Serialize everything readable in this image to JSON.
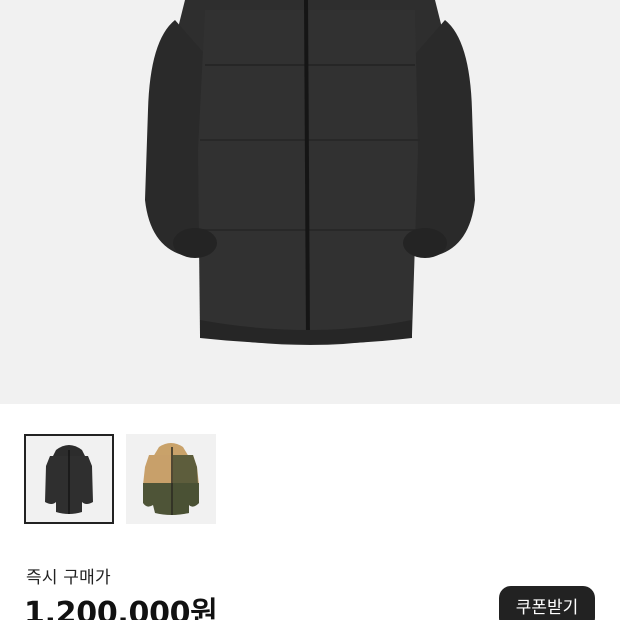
{
  "product": {
    "main_image": "black-insulated-jacket-photo",
    "thumbnails": [
      {
        "name": "black-jacket-thumbnail",
        "selected": true
      },
      {
        "name": "tan-olive-jacket-thumbnail",
        "selected": false
      }
    ]
  },
  "purchase": {
    "price_label": "즉시 구매가",
    "price_value": "1,200,000원",
    "coupon_button": "쿠폰받기"
  },
  "colors": {
    "hero_bg": "#f1f1f1",
    "jacket_black": "#2b2b2b",
    "button_bg": "#222222",
    "button_text": "#ffffff"
  }
}
